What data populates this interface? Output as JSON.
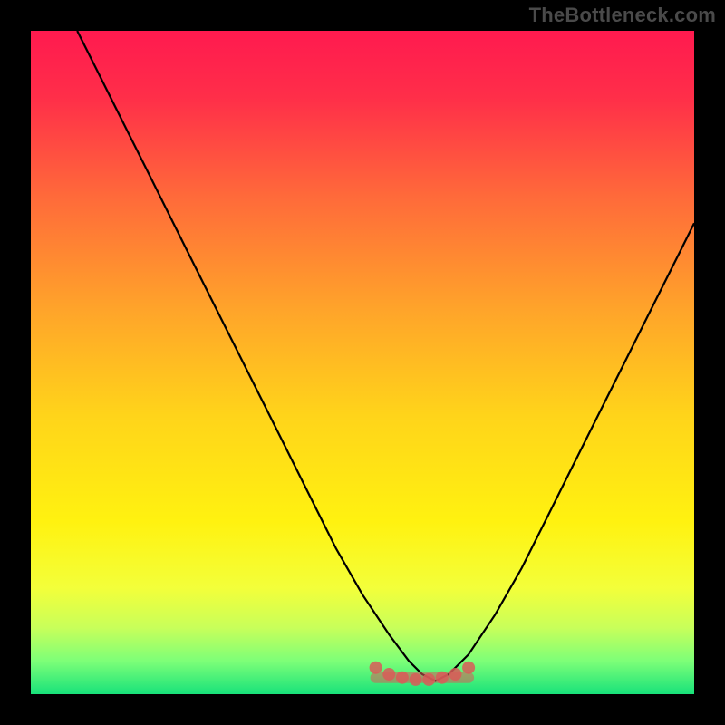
{
  "watermark": "TheBottleneck.com",
  "colors": {
    "frame": "#000000",
    "gradient_stops": [
      {
        "offset": 0.0,
        "color": "#ff1a4f"
      },
      {
        "offset": 0.1,
        "color": "#ff2e49"
      },
      {
        "offset": 0.25,
        "color": "#ff6a3a"
      },
      {
        "offset": 0.42,
        "color": "#ffa42a"
      },
      {
        "offset": 0.58,
        "color": "#ffd41a"
      },
      {
        "offset": 0.74,
        "color": "#fff210"
      },
      {
        "offset": 0.84,
        "color": "#f3ff3a"
      },
      {
        "offset": 0.9,
        "color": "#c8ff5a"
      },
      {
        "offset": 0.95,
        "color": "#7dff78"
      },
      {
        "offset": 1.0,
        "color": "#18e27a"
      }
    ],
    "curve": "#000000",
    "marker": "#d95a58"
  },
  "chart_data": {
    "type": "line",
    "title": "",
    "xlabel": "",
    "ylabel": "",
    "xlim": [
      0,
      100
    ],
    "ylim": [
      0,
      100
    ],
    "grid": false,
    "legend": false,
    "series": [
      {
        "name": "curve",
        "x": [
          7,
          10,
          14,
          18,
          22,
          26,
          30,
          34,
          38,
          42,
          46,
          50,
          54,
          57,
          59,
          61,
          63,
          66,
          70,
          74,
          78,
          82,
          86,
          90,
          94,
          98,
          100
        ],
        "y": [
          100,
          94,
          86,
          78,
          70,
          62,
          54,
          46,
          38,
          30,
          22,
          15,
          9,
          5,
          3,
          2,
          3,
          6,
          12,
          19,
          27,
          35,
          43,
          51,
          59,
          67,
          71
        ]
      },
      {
        "name": "flat-bottom-markers",
        "x": [
          52,
          54,
          56,
          58,
          60,
          62,
          64,
          66
        ],
        "y": [
          4,
          3,
          2.5,
          2.2,
          2.2,
          2.5,
          3,
          4
        ]
      }
    ]
  }
}
